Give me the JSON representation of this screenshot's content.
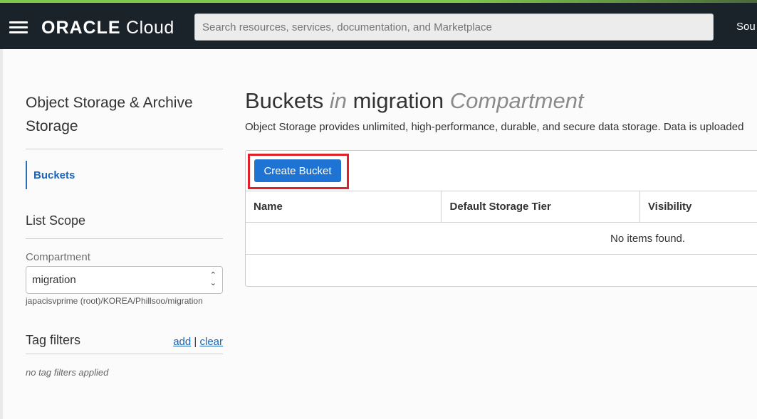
{
  "header": {
    "logo_brand": "ORACLE",
    "logo_product": "Cloud",
    "search_placeholder": "Search resources, services, documentation, and Marketplace",
    "region_label": "Sou"
  },
  "sidebar": {
    "title": "Object Storage & Archive Storage",
    "nav_items": [
      {
        "label": "Buckets",
        "active": true
      }
    ],
    "list_scope_heading": "List Scope",
    "compartment_label": "Compartment",
    "compartment_value": "migration",
    "compartment_path": "japacisvprime (root)/KOREA/Phillsoo/migration",
    "tag_filters_heading": "Tag filters",
    "tag_add_label": "add",
    "tag_separator": "|",
    "tag_clear_label": "clear",
    "no_tags_text": "no tag filters applied"
  },
  "main": {
    "title_part1": "Buckets",
    "title_in": "in",
    "title_compartment_name": "migration",
    "title_compartment_word": "Compartment",
    "description": "Object Storage provides unlimited, high-performance, durable, and secure data storage. Data is uploaded",
    "create_button_label": "Create Bucket",
    "table": {
      "columns": [
        "Name",
        "Default Storage Tier",
        "Visibility"
      ],
      "rows": [],
      "empty_text": "No items found."
    }
  },
  "colors": {
    "header_bg": "#1a232a",
    "primary_button": "#1f74d3",
    "link": "#1c63b8",
    "highlight_box": "#e0202a"
  }
}
